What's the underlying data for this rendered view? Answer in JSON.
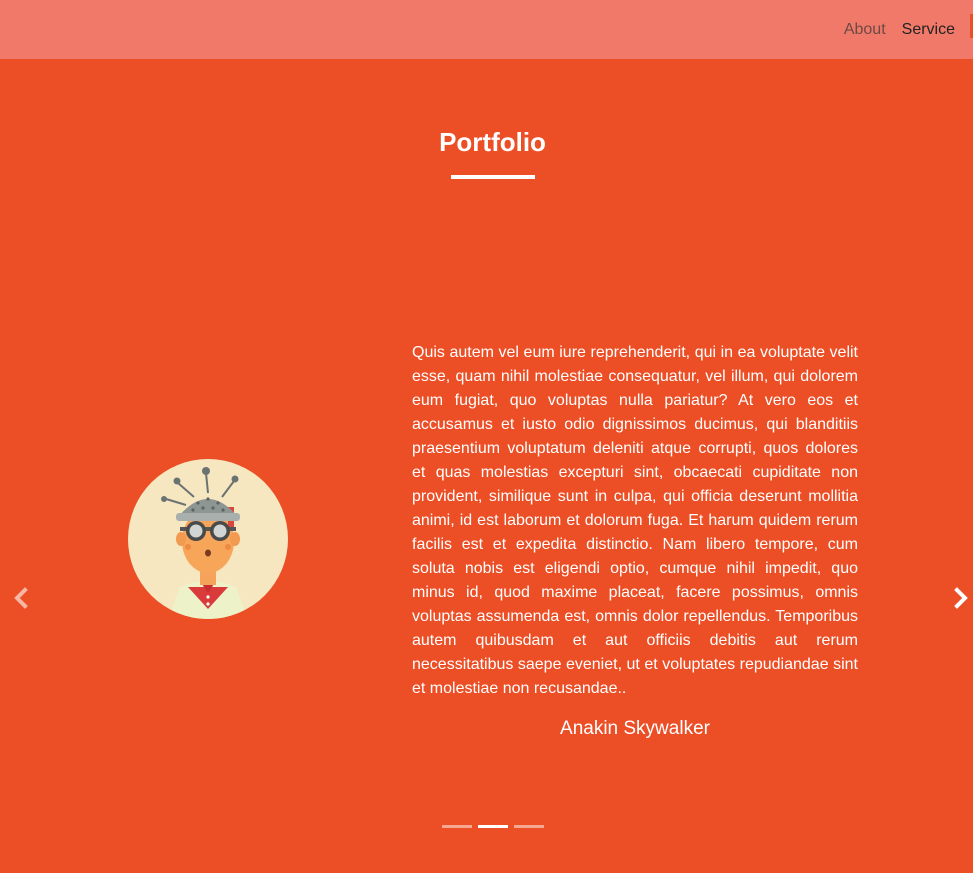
{
  "nav": {
    "items": [
      {
        "label": "About"
      },
      {
        "label": "Service"
      }
    ]
  },
  "portfolio": {
    "title": "Portfolio"
  },
  "testimonial": {
    "quote": "Quis autem vel eum iure reprehenderit, qui in ea voluptate velit esse, quam nihil molestiae consequatur, vel illum, qui dolorem eum fugiat, quo voluptas nulla pariatur? At vero eos et accusamus et iusto odio dignissimos ducimus, qui blanditiis praesentium voluptatum deleniti atque corrupti, quos dolores et quas molestias excepturi sint, obcaecati cupiditate non provident, similique sunt in culpa, qui officia deserunt mollitia animi, id est laborum et dolorum fuga. Et harum quidem rerum facilis est et expedita distinctio. Nam libero tempore, cum soluta nobis est eligendi optio, cumque nihil impedit, quo minus id, quod maxime placeat, facere possimus, omnis voluptas assumenda est, omnis dolor repellendus. Temporibus autem quibusdam et aut officiis debitis aut rerum necessitatibus saepe eveniet, ut et voluptates repudiandae sint et molestiae non recusandae..",
    "author": "Anakin Skywalker",
    "avatar_icon": "scientist-avatar"
  },
  "carousel": {
    "prev_icon": "chevron-left-icon",
    "next_icon": "chevron-right-icon",
    "slide_count": 3,
    "active_index": 1
  },
  "colors": {
    "background": "#ec4e25",
    "header": "#f17969",
    "text": "#ffffff"
  }
}
